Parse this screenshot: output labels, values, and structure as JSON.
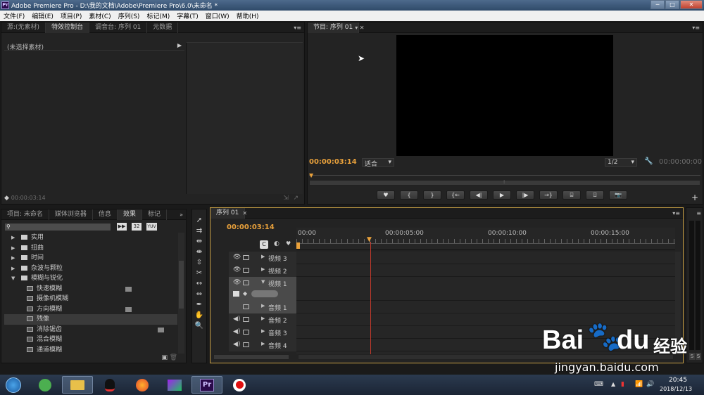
{
  "window": {
    "title": "Adobe Premiere Pro - D:\\我的文档\\Adobe\\Premiere Pro\\6.0\\未命名 *",
    "logo": "Pr",
    "min": "─",
    "max": "□",
    "close": "✕"
  },
  "menu": [
    "文件(F)",
    "编辑(E)",
    "项目(P)",
    "素材(C)",
    "序列(S)",
    "标记(M)",
    "字幕(T)",
    "窗口(W)",
    "帮助(H)"
  ],
  "source_panel": {
    "tabs": [
      "源:(无素材)",
      "特效控制台",
      "调音台: 序列 01",
      "元数据"
    ],
    "no_clip": "(未选择素材)",
    "timecode": "00:00:03:14"
  },
  "program_monitor": {
    "tab": "节目: 序列 01",
    "timecode": "00:00:03:14",
    "fit": "适合",
    "quality": "1/2",
    "duration": "00:00:00:00"
  },
  "effects_panel": {
    "tabs": [
      "项目: 未命名",
      "媒体浏览器",
      "信息",
      "效果",
      "标记"
    ],
    "badges": [
      "32",
      "YUV"
    ],
    "items": [
      {
        "label": "实用",
        "type": "folder",
        "level": 0
      },
      {
        "label": "扭曲",
        "type": "folder",
        "level": 0
      },
      {
        "label": "时间",
        "type": "folder",
        "level": 0
      },
      {
        "label": "杂波与颗粒",
        "type": "folder",
        "level": 0
      },
      {
        "label": "模糊与锐化",
        "type": "folder",
        "level": 0,
        "open": true
      },
      {
        "label": "快速模糊",
        "type": "fx",
        "level": 1,
        "badge": true
      },
      {
        "label": "摄像机模糊",
        "type": "fx",
        "level": 1
      },
      {
        "label": "方向模糊",
        "type": "fx",
        "level": 1,
        "badge": true
      },
      {
        "label": "残像",
        "type": "fx",
        "level": 1,
        "selected": true
      },
      {
        "label": "消除锯齿",
        "type": "fx",
        "level": 1,
        "badge": true
      },
      {
        "label": "混合模糊",
        "type": "fx",
        "level": 1
      },
      {
        "label": "通道模糊",
        "type": "fx",
        "level": 1
      }
    ]
  },
  "timeline": {
    "tab": "序列 01",
    "timecode": "00:00:03:14",
    "ruler": [
      "00:00",
      "00:00:05:00",
      "00:00:10:00",
      "00:00:15:00"
    ],
    "tracks": [
      "视频 3",
      "视频 2",
      "视频 1",
      "音频 1",
      "音频 2",
      "音频 3",
      "音频 4"
    ]
  },
  "audio_meter": {
    "solo": "S"
  },
  "taskbar": {
    "time": "20:45",
    "date": "2018/12/13",
    "pr_label": "Pr"
  },
  "watermark": {
    "brand": "Bai",
    "brand2": "du",
    "sub": "经验",
    "url": "jingyan.baidu.com"
  },
  "colors": {
    "accent_timecode": "#e9a13b",
    "playhead": "#c0392b",
    "window_title": "#2f4a69"
  }
}
